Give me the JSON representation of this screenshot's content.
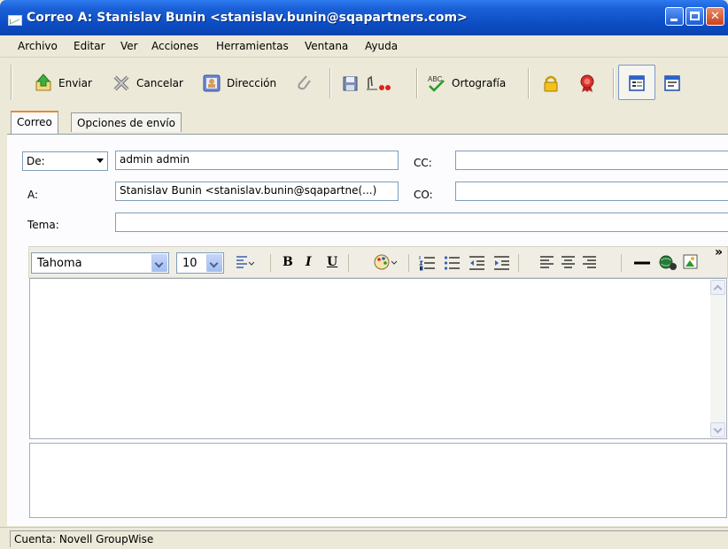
{
  "window": {
    "title": "Correo A: Stanislav Bunin <stanislav.bunin@sqapartners.com>"
  },
  "menu": [
    "Archivo",
    "Editar",
    "Ver",
    "Acciones",
    "Herramientas",
    "Ventana",
    "Ayuda"
  ],
  "toolbar": {
    "send_label": "Enviar",
    "cancel_label": "Cancelar",
    "address_label": "Dirección",
    "spell_label": "Ortografía",
    "spell_icon_text": "ABC"
  },
  "tabs": [
    "Correo",
    "Opciones de envío"
  ],
  "fields": {
    "from_select": "De:",
    "from_value": "admin admin",
    "to_label": "A:",
    "to_value": "Stanislav Bunin <stanislav.bunin@sqapartne(...)",
    "cc_label": "CC:",
    "cc_value": "",
    "bcc_label": "CO:",
    "bcc_value": "",
    "subject_label": "Tema:",
    "subject_value": ""
  },
  "format_bar": {
    "font": "Tahoma",
    "size": "10",
    "bold": "B",
    "italic": "I",
    "underline": "U",
    "more": "»"
  },
  "status": {
    "account": "Cuenta: Novell GroupWise"
  },
  "colors": {
    "titlebar": "#0c4cc2",
    "chrome": "#ece9d8",
    "tab_accent": "#e68b2c"
  }
}
